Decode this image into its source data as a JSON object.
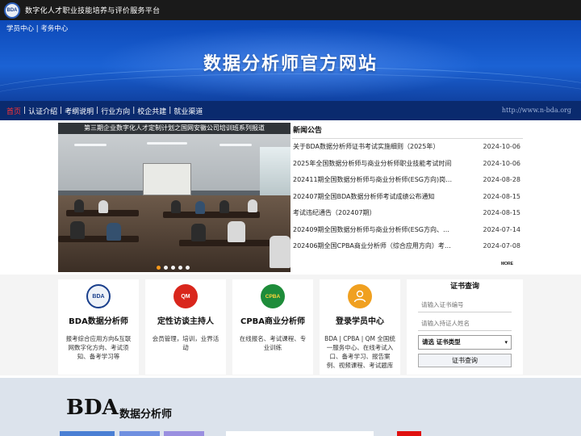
{
  "topbar": {
    "logo_text": "BDA",
    "platform_title": "数字化人才职业技能培养与评价服务平台"
  },
  "banner": {
    "link_student": "学员中心",
    "link_sep": " | ",
    "link_exam": "考务中心",
    "site_title": "数据分析师官方网站"
  },
  "nav": {
    "items": [
      "首页",
      "认证介绍",
      "考纲说明",
      "行业方向",
      "校企共建",
      "就业渠道"
    ],
    "url": "http://www.n-bda.org",
    "active_color": "#ff3333"
  },
  "slider": {
    "caption": "第三期企业数字化人才定制计划之国网安徽公司培训班系列报道",
    "dots": 5,
    "active_dot": 0
  },
  "news": {
    "heading": "新闻公告",
    "items": [
      {
        "title": "关于BDA数据分析师证书考试实施细则（2025年）",
        "date": "2024-10-06"
      },
      {
        "title": "2025年全国数据分析师与商业分析师职业技能考试时间",
        "date": "2024-10-06"
      },
      {
        "title": "202411期全国数据分析师与商业分析师(ESG方向)岗位...",
        "date": "2024-08-28"
      },
      {
        "title": "202407期全国BDA数据分析师考试成绩公布通知",
        "date": "2024-08-15"
      },
      {
        "title": "考试违纪通告（202407期）",
        "date": "2024-08-15"
      },
      {
        "title": "202409期全国数据分析师与商业分析师(ESG方向、气...",
        "date": "2024-07-14"
      },
      {
        "title": "202406期全国CPBA商业分析师（综合应用方向）考试...",
        "date": "2024-07-08"
      }
    ],
    "more": "MORE"
  },
  "cards": [
    {
      "badge": "BDA",
      "badge_icon": "bda-logo-icon",
      "badge_color": "#1a3f8c",
      "title": "BDA数据分析师",
      "desc": "报考综合应用方向&互联网数字化方向、考试须知、备考学习等"
    },
    {
      "badge": "QM",
      "badge_icon": "qm-logo-icon",
      "badge_color": "#d9261c",
      "title": "定性访谈主持人",
      "desc": "会员管理，培训，业界活动"
    },
    {
      "badge": "CPBA",
      "badge_icon": "cpba-logo-icon",
      "badge_color": "#1e8c3a",
      "title": "CPBA商业分析师",
      "desc": "在线报名、考试课程、专业训练"
    },
    {
      "badge": "",
      "badge_icon": "user-icon",
      "badge_color": "#f0a020",
      "title": "登录学员中心",
      "desc": "BDA | CPBA | QM 全国统一服务中心、在线考试入口、备考学习、报告案例、视频课程、考试题库"
    }
  ],
  "query": {
    "title": "证书查询",
    "cert_placeholder": "请输入证书编号",
    "name_placeholder": "请输入持证人姓名",
    "select_value": "请选 证书类型",
    "button_label": "证书查询"
  },
  "bottom": {
    "brand": "BDA",
    "brand_sub": "数据分析师"
  }
}
